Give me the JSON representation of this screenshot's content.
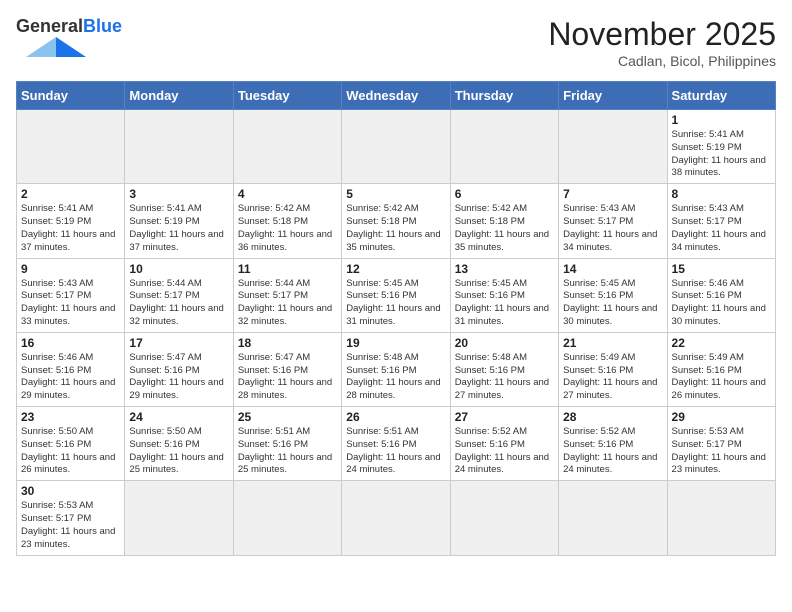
{
  "header": {
    "logo_general": "General",
    "logo_blue": "Blue",
    "month_title": "November 2025",
    "location": "Cadlan, Bicol, Philippines"
  },
  "weekdays": [
    "Sunday",
    "Monday",
    "Tuesday",
    "Wednesday",
    "Thursday",
    "Friday",
    "Saturday"
  ],
  "weeks": [
    [
      {
        "day": "",
        "info": ""
      },
      {
        "day": "",
        "info": ""
      },
      {
        "day": "",
        "info": ""
      },
      {
        "day": "",
        "info": ""
      },
      {
        "day": "",
        "info": ""
      },
      {
        "day": "",
        "info": ""
      },
      {
        "day": "1",
        "info": "Sunrise: 5:41 AM\nSunset: 5:19 PM\nDaylight: 11 hours and 38 minutes."
      }
    ],
    [
      {
        "day": "2",
        "info": "Sunrise: 5:41 AM\nSunset: 5:19 PM\nDaylight: 11 hours and 37 minutes."
      },
      {
        "day": "3",
        "info": "Sunrise: 5:41 AM\nSunset: 5:19 PM\nDaylight: 11 hours and 37 minutes."
      },
      {
        "day": "4",
        "info": "Sunrise: 5:42 AM\nSunset: 5:18 PM\nDaylight: 11 hours and 36 minutes."
      },
      {
        "day": "5",
        "info": "Sunrise: 5:42 AM\nSunset: 5:18 PM\nDaylight: 11 hours and 35 minutes."
      },
      {
        "day": "6",
        "info": "Sunrise: 5:42 AM\nSunset: 5:18 PM\nDaylight: 11 hours and 35 minutes."
      },
      {
        "day": "7",
        "info": "Sunrise: 5:43 AM\nSunset: 5:17 PM\nDaylight: 11 hours and 34 minutes."
      },
      {
        "day": "8",
        "info": "Sunrise: 5:43 AM\nSunset: 5:17 PM\nDaylight: 11 hours and 34 minutes."
      }
    ],
    [
      {
        "day": "9",
        "info": "Sunrise: 5:43 AM\nSunset: 5:17 PM\nDaylight: 11 hours and 33 minutes."
      },
      {
        "day": "10",
        "info": "Sunrise: 5:44 AM\nSunset: 5:17 PM\nDaylight: 11 hours and 32 minutes."
      },
      {
        "day": "11",
        "info": "Sunrise: 5:44 AM\nSunset: 5:17 PM\nDaylight: 11 hours and 32 minutes."
      },
      {
        "day": "12",
        "info": "Sunrise: 5:45 AM\nSunset: 5:16 PM\nDaylight: 11 hours and 31 minutes."
      },
      {
        "day": "13",
        "info": "Sunrise: 5:45 AM\nSunset: 5:16 PM\nDaylight: 11 hours and 31 minutes."
      },
      {
        "day": "14",
        "info": "Sunrise: 5:45 AM\nSunset: 5:16 PM\nDaylight: 11 hours and 30 minutes."
      },
      {
        "day": "15",
        "info": "Sunrise: 5:46 AM\nSunset: 5:16 PM\nDaylight: 11 hours and 30 minutes."
      }
    ],
    [
      {
        "day": "16",
        "info": "Sunrise: 5:46 AM\nSunset: 5:16 PM\nDaylight: 11 hours and 29 minutes."
      },
      {
        "day": "17",
        "info": "Sunrise: 5:47 AM\nSunset: 5:16 PM\nDaylight: 11 hours and 29 minutes."
      },
      {
        "day": "18",
        "info": "Sunrise: 5:47 AM\nSunset: 5:16 PM\nDaylight: 11 hours and 28 minutes."
      },
      {
        "day": "19",
        "info": "Sunrise: 5:48 AM\nSunset: 5:16 PM\nDaylight: 11 hours and 28 minutes."
      },
      {
        "day": "20",
        "info": "Sunrise: 5:48 AM\nSunset: 5:16 PM\nDaylight: 11 hours and 27 minutes."
      },
      {
        "day": "21",
        "info": "Sunrise: 5:49 AM\nSunset: 5:16 PM\nDaylight: 11 hours and 27 minutes."
      },
      {
        "day": "22",
        "info": "Sunrise: 5:49 AM\nSunset: 5:16 PM\nDaylight: 11 hours and 26 minutes."
      }
    ],
    [
      {
        "day": "23",
        "info": "Sunrise: 5:50 AM\nSunset: 5:16 PM\nDaylight: 11 hours and 26 minutes."
      },
      {
        "day": "24",
        "info": "Sunrise: 5:50 AM\nSunset: 5:16 PM\nDaylight: 11 hours and 25 minutes."
      },
      {
        "day": "25",
        "info": "Sunrise: 5:51 AM\nSunset: 5:16 PM\nDaylight: 11 hours and 25 minutes."
      },
      {
        "day": "26",
        "info": "Sunrise: 5:51 AM\nSunset: 5:16 PM\nDaylight: 11 hours and 24 minutes."
      },
      {
        "day": "27",
        "info": "Sunrise: 5:52 AM\nSunset: 5:16 PM\nDaylight: 11 hours and 24 minutes."
      },
      {
        "day": "28",
        "info": "Sunrise: 5:52 AM\nSunset: 5:16 PM\nDaylight: 11 hours and 24 minutes."
      },
      {
        "day": "29",
        "info": "Sunrise: 5:53 AM\nSunset: 5:17 PM\nDaylight: 11 hours and 23 minutes."
      }
    ],
    [
      {
        "day": "30",
        "info": "Sunrise: 5:53 AM\nSunset: 5:17 PM\nDaylight: 11 hours and 23 minutes."
      },
      {
        "day": "",
        "info": ""
      },
      {
        "day": "",
        "info": ""
      },
      {
        "day": "",
        "info": ""
      },
      {
        "day": "",
        "info": ""
      },
      {
        "day": "",
        "info": ""
      },
      {
        "day": "",
        "info": ""
      }
    ]
  ]
}
